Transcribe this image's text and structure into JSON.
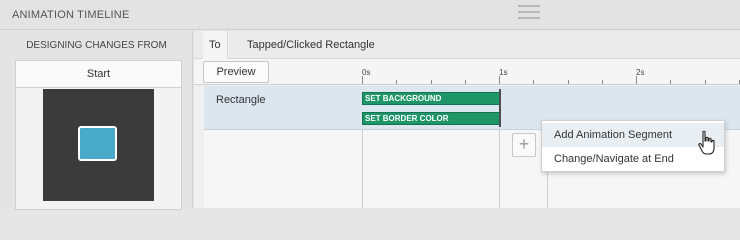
{
  "window": {
    "title": "ANIMATION TIMELINE"
  },
  "left_panel": {
    "heading": "DESIGNING CHANGES FROM",
    "state_label": "Start",
    "preview_rect_color": "#49a9c9"
  },
  "timeline": {
    "to_label": "To",
    "target_state": "Tapped/Clicked Rectangle",
    "preview_button": "Preview",
    "ruler": {
      "labels": [
        "0s",
        "1s",
        "2s"
      ]
    },
    "tracks": [
      {
        "name": "Rectangle",
        "segments": [
          {
            "label": "SET BACKGROUND",
            "color": "#1f9668"
          },
          {
            "label": "SET BORDER COLOR",
            "color": "#1f9668"
          }
        ]
      }
    ],
    "add_button_icon": "plus-icon"
  },
  "context_menu": {
    "items": [
      {
        "label": "Add Animation Segment",
        "highlighted": true
      },
      {
        "label": "Change/Navigate at End",
        "highlighted": false
      }
    ]
  },
  "cursor": "hand-pointer-icon"
}
